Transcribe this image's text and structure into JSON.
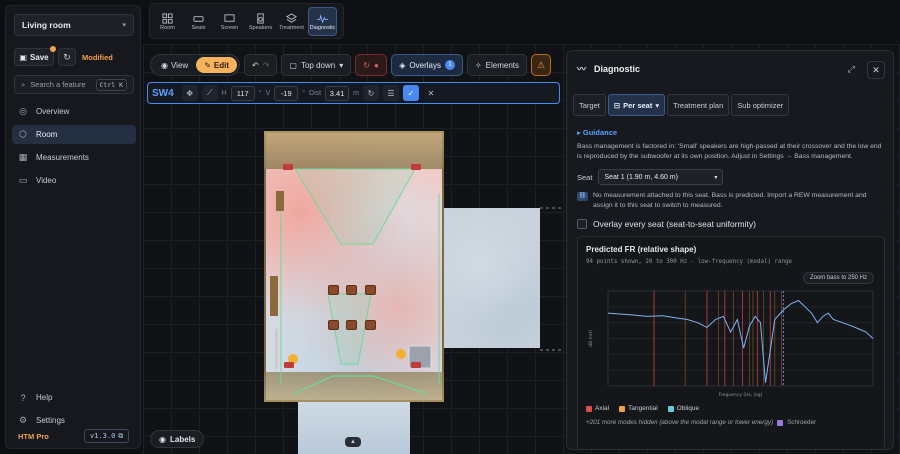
{
  "sidebar": {
    "room_select": "Living room",
    "save_label": "Save",
    "modified_label": "Modified",
    "search_placeholder": "Search a feature",
    "search_shortcut": "Ctrl K",
    "nav": [
      {
        "label": "Overview",
        "icon": "compass-icon"
      },
      {
        "label": "Room",
        "icon": "cube-icon",
        "active": true
      },
      {
        "label": "Measurements",
        "icon": "gauge-icon"
      },
      {
        "label": "Video",
        "icon": "monitor-icon"
      }
    ],
    "help_label": "Help",
    "settings_label": "Settings",
    "plan_label": "HTM Pro",
    "version_label": "v1.3.0"
  },
  "toolbar": {
    "tools": [
      {
        "label": "Room",
        "icon": "grid-icon"
      },
      {
        "label": "Seats",
        "icon": "sofa-icon"
      },
      {
        "label": "Screen",
        "icon": "screen-icon"
      },
      {
        "label": "Speakers",
        "icon": "speaker-icon"
      },
      {
        "label": "Treatment",
        "icon": "layers-icon"
      },
      {
        "label": "Diagnostic",
        "icon": "pulse-icon",
        "active": true
      }
    ]
  },
  "viewbar": {
    "view_label": "View",
    "edit_label": "Edit",
    "camera_label": "Top down",
    "overlays_label": "Overlays",
    "overlays_count": "1",
    "elements_label": "Elements"
  },
  "editbar": {
    "name": "SW4",
    "h_label": "H",
    "h_value": "117",
    "v_label": "V",
    "v_value": "-19",
    "dist_label": "Dist",
    "dist_value": "3.41",
    "unit": "m",
    "deg": "°"
  },
  "canvas": {
    "labels_button": "Labels"
  },
  "diagnostic": {
    "title": "Diagnostic",
    "tabs": [
      "Target",
      "Per seat",
      "Treatment plan",
      "Sub optimizer"
    ],
    "active_tab": "Per seat",
    "guidance_label": "Guidance",
    "guidance_text": "Bass management is factored in: 'Small' speakers are high-passed at their crossover and the low end is reproduced by the subwoofer at its own position. Adjust in Settings → Bass management.",
    "seat_label": "Seat",
    "seat_value": "Seat 1 (1.90 m, 4.60 m)",
    "info_text": "No measurement attached to this seat. Bass is predicted. Import a REW measurement and assign it to this seat to switch to measured.",
    "overlay_checkbox": "Overlay every seat (seat-to-seat uniformity)",
    "chart_title": "Predicted FR (relative shape)",
    "chart_subtitle": "94 points shown, 20 to 300 Hz - low-frequency (modal) range",
    "zoom_label": "Zoom bass to 250 Hz",
    "legend": [
      {
        "name": "Axial",
        "color": "#e0504a"
      },
      {
        "name": "Tangential",
        "color": "#f0a24a"
      },
      {
        "name": "Oblique",
        "color": "#5ad0d8"
      }
    ],
    "more_text": "+201 more modes hidden (above the modal range or lower energy)",
    "schroeder_label": "Schroeder"
  },
  "chart_data": {
    "type": "line",
    "title": "Predicted FR (relative shape)",
    "subtitle": "94 points shown, 20 to 300 Hz - low-frequency (modal) range",
    "xlabel": "Frequency (Hz, log)",
    "ylabel": "dB (rel)",
    "xlim": [
      20,
      300
    ],
    "ylim": [
      -24,
      6
    ],
    "x": [
      20,
      25,
      30,
      35,
      40,
      45,
      50,
      55,
      60,
      65,
      70,
      75,
      80,
      85,
      90,
      95,
      100,
      110,
      120,
      130,
      140,
      150,
      160,
      170,
      180,
      190,
      200,
      220,
      240,
      260,
      280,
      300
    ],
    "series": [
      {
        "values": [
          -1,
          -1.5,
          -2,
          -1.8,
          -2.5,
          -3,
          -4,
          -5.5,
          -3,
          -2,
          -7,
          -3,
          -12,
          -5,
          -2,
          -4,
          -23,
          -3,
          0,
          2,
          3,
          1,
          -1,
          -4,
          -2,
          -1,
          -3,
          -4,
          -5,
          -6,
          -7,
          -9
        ]
      }
    ],
    "axial_modes": [
      32,
      55,
      66,
      79,
      92,
      105
    ],
    "tangential_modes": [
      44,
      62,
      72,
      85,
      88,
      98,
      110,
      118
    ],
    "schroeder_hz": 120
  }
}
